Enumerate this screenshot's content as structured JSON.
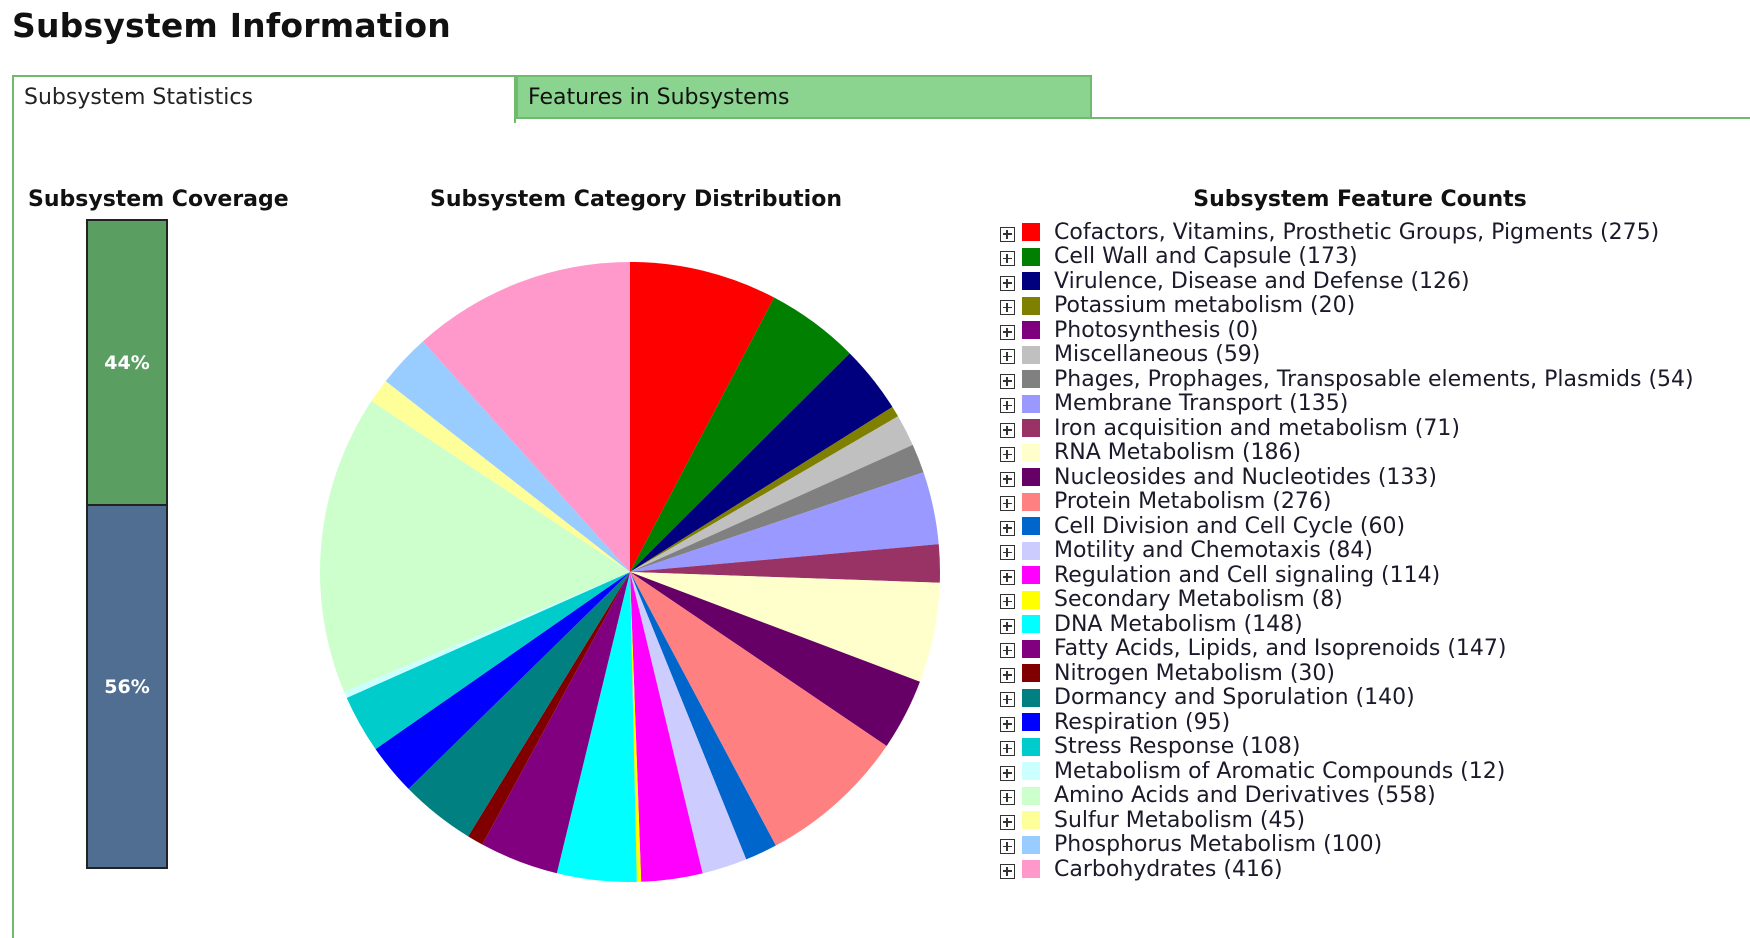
{
  "page": {
    "title": "Subsystem Information"
  },
  "tabs": [
    {
      "label": "Subsystem Statistics",
      "active": true
    },
    {
      "label": "Features in Subsystems",
      "active": false
    }
  ],
  "colors": {
    "tab_border": "#6fba6f",
    "tab_inactive_bg": "#8bd48f"
  },
  "coverage": {
    "title": "Subsystem Coverage",
    "segments": [
      {
        "label": "44%",
        "value": 44,
        "color": "#5a9e62"
      },
      {
        "label": "56%",
        "value": 56,
        "color": "#4f6e91"
      }
    ]
  },
  "chart_data": {
    "type": "pie",
    "title": "Subsystem Category Distribution",
    "legend_title": "Subsystem Feature Counts",
    "start_angle": "12 o'clock, clockwise",
    "slices": [
      {
        "label": "Cofactors, Vitamins, Prosthetic Groups, Pigments",
        "value": 275,
        "color": "#ff0000"
      },
      {
        "label": "Cell Wall and Capsule",
        "value": 173,
        "color": "#007f00"
      },
      {
        "label": "Virulence, Disease and Defense",
        "value": 126,
        "color": "#00007f"
      },
      {
        "label": "Potassium metabolism",
        "value": 20,
        "color": "#7f7f00"
      },
      {
        "label": "Photosynthesis",
        "value": 0,
        "color": "#7f007f"
      },
      {
        "label": "Miscellaneous",
        "value": 59,
        "color": "#c0c0c0"
      },
      {
        "label": "Phages, Prophages, Transposable elements, Plasmids",
        "value": 54,
        "color": "#808080"
      },
      {
        "label": "Membrane Transport",
        "value": 135,
        "color": "#9999ff"
      },
      {
        "label": "Iron acquisition and metabolism",
        "value": 71,
        "color": "#993366"
      },
      {
        "label": "RNA Metabolism",
        "value": 186,
        "color": "#ffffcc"
      },
      {
        "label": "Nucleosides and Nucleotides",
        "value": 133,
        "color": "#660066"
      },
      {
        "label": "Protein Metabolism",
        "value": 276,
        "color": "#ff8080"
      },
      {
        "label": "Cell Division and Cell Cycle",
        "value": 60,
        "color": "#0066cc"
      },
      {
        "label": "Motility and Chemotaxis",
        "value": 84,
        "color": "#ccccff"
      },
      {
        "label": "Regulation and Cell signaling",
        "value": 114,
        "color": "#ff00ff"
      },
      {
        "label": "Secondary Metabolism",
        "value": 8,
        "color": "#ffff00"
      },
      {
        "label": "DNA Metabolism",
        "value": 148,
        "color": "#00ffff"
      },
      {
        "label": "Fatty Acids, Lipids, and Isoprenoids",
        "value": 147,
        "color": "#800080"
      },
      {
        "label": "Nitrogen Metabolism",
        "value": 30,
        "color": "#800000"
      },
      {
        "label": "Dormancy and Sporulation",
        "value": 140,
        "color": "#008080"
      },
      {
        "label": "Respiration",
        "value": 95,
        "color": "#0000ff"
      },
      {
        "label": "Stress Response",
        "value": 108,
        "color": "#00cccc"
      },
      {
        "label": "Metabolism of Aromatic Compounds",
        "value": 12,
        "color": "#ccffff"
      },
      {
        "label": "Amino Acids and Derivatives",
        "value": 558,
        "color": "#ccffcc"
      },
      {
        "label": "Sulfur Metabolism",
        "value": 45,
        "color": "#ffff99"
      },
      {
        "label": "Phosphorus Metabolism",
        "value": 100,
        "color": "#99ccff"
      },
      {
        "label": "Carbohydrates",
        "value": 416,
        "color": "#ff99cc"
      }
    ]
  },
  "legend_entries": [
    "Cofactors, Vitamins, Prosthetic Groups, Pigments (275)",
    "Cell Wall and Capsule (173)",
    "Virulence, Disease and Defense (126)",
    "Potassium metabolism (20)",
    "Photosynthesis (0)",
    "Miscellaneous (59)",
    "Phages, Prophages, Transposable elements, Plasmids (54)",
    "Membrane Transport (135)",
    "Iron acquisition and metabolism (71)",
    "RNA Metabolism (186)",
    "Nucleosides and Nucleotides (133)",
    "Protein Metabolism (276)",
    "Cell Division and Cell Cycle (60)",
    "Motility and Chemotaxis (84)",
    "Regulation and Cell signaling (114)",
    "Secondary Metabolism (8)",
    "DNA Metabolism (148)",
    "Fatty Acids, Lipids, and Isoprenoids (147)",
    "Nitrogen Metabolism (30)",
    "Dormancy and Sporulation (140)",
    "Respiration (95)",
    "Stress Response (108)",
    "Metabolism of Aromatic Compounds (12)",
    "Amino Acids and Derivatives (558)",
    "Sulfur Metabolism (45)",
    "Phosphorus Metabolism (100)",
    "Carbohydrates (416)"
  ]
}
